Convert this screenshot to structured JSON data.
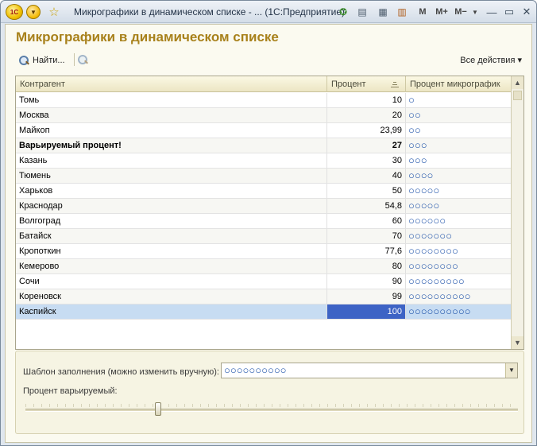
{
  "window": {
    "title": "Микрографики в динамическом списке - ...  (1С:Предприятие)",
    "logo": "1С",
    "controls": {
      "m": "M",
      "mplus": "M+",
      "mminus": "M−",
      "minimize": "—",
      "restore": "▭",
      "close": "✕"
    }
  },
  "form": {
    "title": "Микрографики в динамическом списке",
    "find_label": "Найти...",
    "all_actions_label": "Все действия ▾"
  },
  "table": {
    "columns": [
      "Контрагент",
      "Процент",
      "Процент микрографик"
    ],
    "rows": [
      {
        "name": "Томь",
        "percent": "10",
        "chart": "○"
      },
      {
        "name": "Москва",
        "percent": "20",
        "chart": "○○"
      },
      {
        "name": "Майкоп",
        "percent": "23,99",
        "chart": "○○"
      },
      {
        "name": "Варьируемый процент!",
        "percent": "27",
        "chart": "○○○",
        "bold": true
      },
      {
        "name": "Казань",
        "percent": "30",
        "chart": "○○○"
      },
      {
        "name": "Тюмень",
        "percent": "40",
        "chart": "○○○○"
      },
      {
        "name": "Харьков",
        "percent": "50",
        "chart": "○○○○○"
      },
      {
        "name": "Краснодар",
        "percent": "54,8",
        "chart": "○○○○○"
      },
      {
        "name": "Волгоград",
        "percent": "60",
        "chart": "○○○○○○"
      },
      {
        "name": "Батайск",
        "percent": "70",
        "chart": "○○○○○○○"
      },
      {
        "name": "Кропоткин",
        "percent": "77,6",
        "chart": "○○○○○○○○"
      },
      {
        "name": "Кемерово",
        "percent": "80",
        "chart": "○○○○○○○○"
      },
      {
        "name": "Сочи",
        "percent": "90",
        "chart": "○○○○○○○○○"
      },
      {
        "name": "Кореновск",
        "percent": "99",
        "chart": "○○○○○○○○○○"
      },
      {
        "name": "Каспийск",
        "percent": "100",
        "chart": "○○○○○○○○○○",
        "selected": true
      }
    ]
  },
  "template": {
    "label": "Шаблон заполнения (можно изменить вручную):",
    "value": "○○○○○○○○○○"
  },
  "slider": {
    "label": "Процент варьируемый:",
    "value_percent": 27
  }
}
